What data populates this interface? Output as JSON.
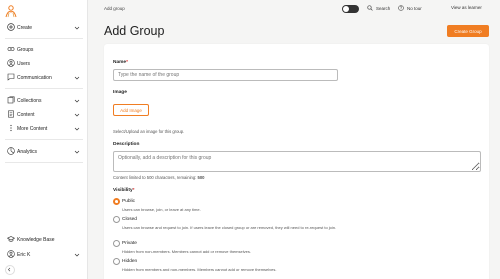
{
  "sidebar": {
    "create": "Create",
    "groups": "Groups",
    "users": "Users",
    "communication": "Communication",
    "collections": "Collections",
    "content": "Content",
    "more_content": "More Content",
    "analytics": "Analytics",
    "knowledge_base": "Knowledge Base",
    "user_name": "Eric K"
  },
  "topbar": {
    "breadcrumb": "Add group",
    "search": "Search",
    "tour": "No tour",
    "view_as_learner": "View as learner"
  },
  "page": {
    "title": "Add Group",
    "create_button": "Create Group"
  },
  "form": {
    "name_label": "Name",
    "name_required": "*",
    "name_placeholder": "Type the name of the group",
    "image_label": "Image",
    "add_image_button": "Add Image",
    "image_hint": "Select/Upload an image for this group.",
    "description_label": "Description",
    "description_placeholder": "Optionally, add a description for this group",
    "char_limit_text": "Content limited to 500 characters, remaining:",
    "char_remaining": "500",
    "visibility_label": "Visibility",
    "visibility_required": "*",
    "visibility_options": [
      {
        "label": "Public",
        "desc": "Users can browse, join, or leave at any time.",
        "selected": true
      },
      {
        "label": "Closed",
        "desc": "Users can browse and request to join. If users leave the closed group or are removed, they will need to re-request to join.",
        "selected": false
      },
      {
        "label": "Private",
        "desc": "Hidden from non-members. Members cannot add or remove themselves.",
        "selected": false
      },
      {
        "label": "Hidden",
        "desc": "Hidden from members and non-members. Members cannot add or remove themselves.",
        "selected": false
      }
    ]
  },
  "colors": {
    "accent": "#f07d22",
    "sidebar_bg": "#ffffff",
    "page_bg": "#f5f5f4"
  }
}
